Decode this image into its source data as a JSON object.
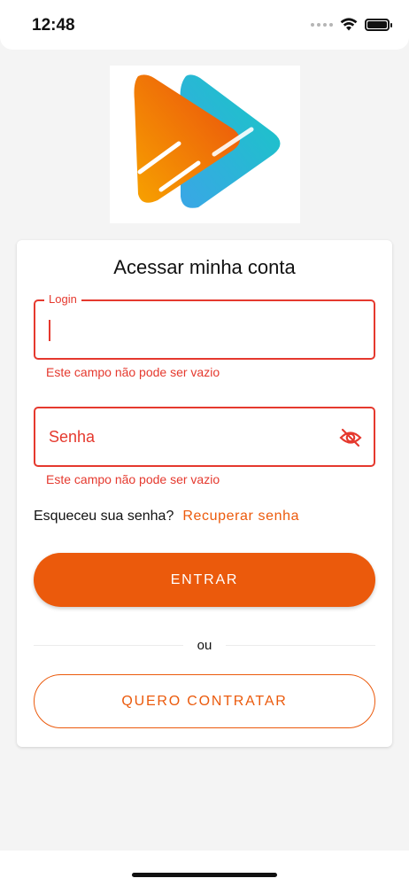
{
  "status_bar": {
    "time": "12:48"
  },
  "login_card": {
    "title": "Acessar minha conta",
    "login_field": {
      "label": "Login",
      "value": "",
      "error": "Este campo não pode ser vazio"
    },
    "password_field": {
      "placeholder": "Senha",
      "value": "",
      "error": "Este campo não pode ser vazio"
    },
    "forgot": {
      "text": "Esqueceu sua senha?",
      "link": "Recuperar senha"
    },
    "enter_button": "ENTRAR",
    "divider": "ou",
    "hire_button": "QUERO CONTRATAR"
  },
  "colors": {
    "brand_orange": "#eb5a0c",
    "error_red": "#e5392e",
    "logo_teal": "#1fc2c9",
    "background": "#f4f4f4"
  }
}
